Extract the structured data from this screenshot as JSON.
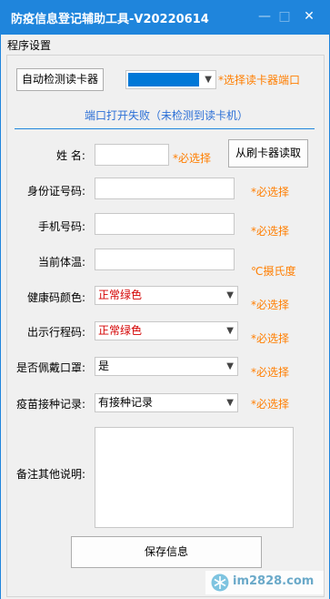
{
  "window": {
    "title": "防疫信息登记辅助工具-V20220614",
    "minimize_glyph": "—",
    "maximize_glyph": "□",
    "close_glyph": "✕"
  },
  "group": {
    "label": "程序设置"
  },
  "reader": {
    "detect_button": "自动检测读卡器",
    "port_value": "",
    "port_note": "*选择读卡器端口",
    "status": "端口打开失败（未检测到读卡机）"
  },
  "form": {
    "name_label": "姓  名:",
    "name_value": "",
    "name_note": "*必选择",
    "read_button": "从刷卡器读取",
    "id_label": "身份证号码:",
    "id_value": "",
    "id_note": "*必选择",
    "phone_label": "手机号码:",
    "phone_value": "",
    "phone_note": "*必选择",
    "temp_label": "当前体温:",
    "temp_value": "",
    "temp_note": "℃摄氏度",
    "health_label": "健康码颜色:",
    "health_value": "正常绿色",
    "health_note": "*必选择",
    "trip_label": "出示行程码:",
    "trip_value": "正常绿色",
    "trip_note": "*必选择",
    "mask_label": "是否佩戴口罩:",
    "mask_value": "是",
    "mask_note": "*必选择",
    "vaccine_label": "疫苗接种记录:",
    "vaccine_value": "有接种记录",
    "vaccine_note": "*必选择",
    "remark_label": "备注其他说明:",
    "remark_value": "",
    "save_button": "保存信息"
  },
  "watermark": {
    "text": "im2828.com"
  },
  "colors": {
    "title_bar": "#1f85dc",
    "note": "#ff7e00",
    "status": "#2b6fd6",
    "health_text": "#d40000"
  }
}
